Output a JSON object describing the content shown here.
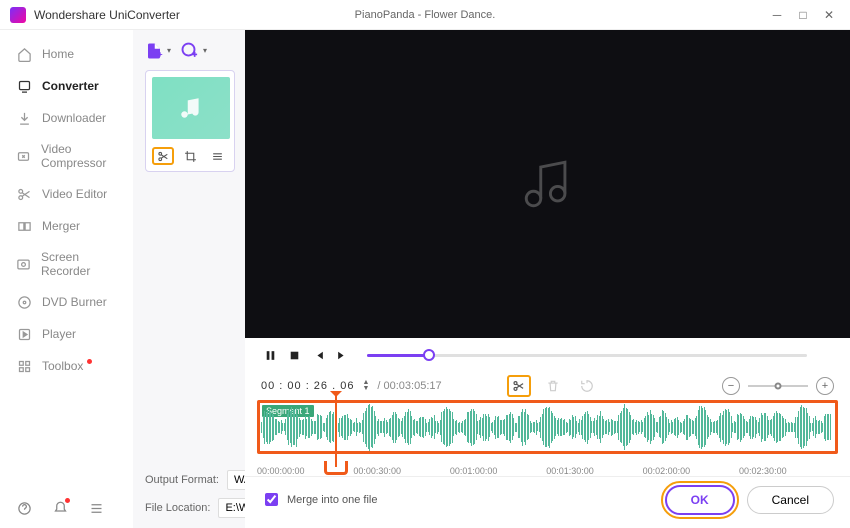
{
  "titlebar": {
    "app": "Wondershare UniConverter",
    "file": "PianoPanda - Flower Dance."
  },
  "sidebar": {
    "items": [
      {
        "label": "Home"
      },
      {
        "label": "Converter"
      },
      {
        "label": "Downloader"
      },
      {
        "label": "Video Compressor"
      },
      {
        "label": "Video Editor"
      },
      {
        "label": "Merger"
      },
      {
        "label": "Screen Recorder"
      },
      {
        "label": "DVD Burner"
      },
      {
        "label": "Player"
      },
      {
        "label": "Toolbox"
      }
    ]
  },
  "form": {
    "output_format_label": "Output Format:",
    "output_format_value": "WAV",
    "file_location_label": "File Location:",
    "file_location_value": "E:\\Wondersh"
  },
  "timecode": {
    "current": "00 : 00 : 26 . 06",
    "duration": "/ 00:03:05:17"
  },
  "waveform": {
    "segment_label": "Segment 1"
  },
  "ruler": [
    "00:00:00:00",
    "00:00:30:00",
    "00:01:00:00",
    "00:01:30:00",
    "00:02:00:00",
    "00:02:30:00"
  ],
  "footer": {
    "merge_label": "Merge into one file",
    "ok": "OK",
    "cancel": "Cancel"
  }
}
